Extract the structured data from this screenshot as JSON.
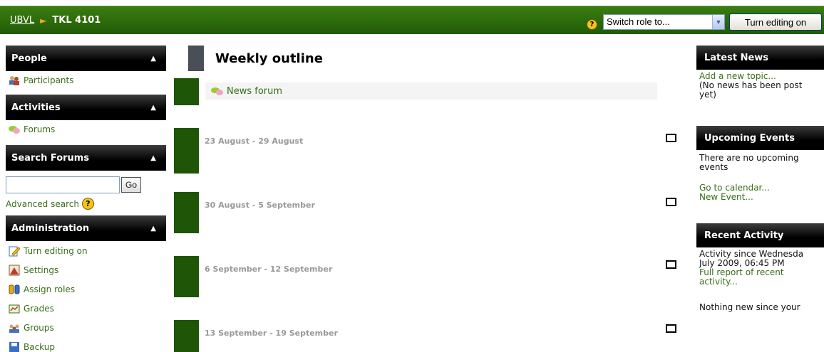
{
  "header": {
    "breadcrumb_home": "UBVL",
    "breadcrumb_course": "TKL 4101",
    "role_select_value": "Switch role to...",
    "edit_button": "Turn editing on"
  },
  "left": {
    "people": {
      "title": "People",
      "items": [
        {
          "label": "Participants",
          "icon": "participants-icon"
        }
      ]
    },
    "activities": {
      "title": "Activities",
      "items": [
        {
          "label": "Forums",
          "icon": "forums-icon"
        }
      ]
    },
    "search": {
      "title": "Search Forums",
      "go_label": "Go",
      "advanced_label": "Advanced search",
      "input_value": ""
    },
    "admin": {
      "title": "Administration",
      "items": [
        {
          "label": "Turn editing on",
          "icon": "edit-icon"
        },
        {
          "label": "Settings",
          "icon": "settings-icon"
        },
        {
          "label": "Assign roles",
          "icon": "roles-icon"
        },
        {
          "label": "Grades",
          "icon": "grades-icon"
        },
        {
          "label": "Groups",
          "icon": "groups-icon"
        },
        {
          "label": "Backup",
          "icon": "backup-icon"
        }
      ]
    }
  },
  "main": {
    "title": "Weekly outline",
    "news_forum": "News forum",
    "weeks": [
      "23 August - 29 August",
      "30 August - 5 September",
      "6 September - 12 September",
      "13 September - 19 September"
    ]
  },
  "right": {
    "latest_news": {
      "title": "Latest News",
      "link": "Add a new topic...",
      "text1": "(No news has been post",
      "text2": "yet)"
    },
    "upcoming": {
      "title": "Upcoming Events",
      "text1": "There are no upcoming",
      "text2": "events",
      "link1": "Go to calendar...",
      "link2": "New Event..."
    },
    "recent": {
      "title": "Recent Activity",
      "text1": "Activity since Wednesda",
      "text2": "July 2009, 06:45 PM",
      "link1": "Full report of recent",
      "link2": "activity...",
      "text3": "Nothing new since your"
    }
  },
  "colors": {
    "header_green": "#215b06",
    "link_green": "#3a6e1a",
    "block_header": "#000000"
  }
}
